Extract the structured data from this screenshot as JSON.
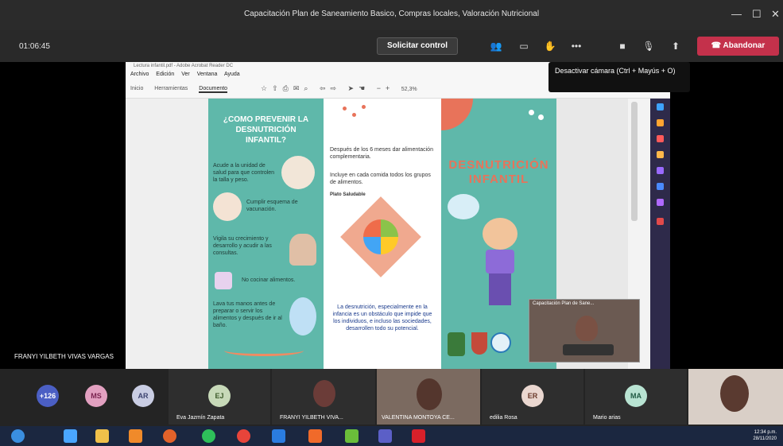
{
  "window": {
    "title": "Capacitación Plan de Saneamiento Basico, Compras locales, Valoración Nutricional",
    "minimize": "—",
    "maximize": "☐",
    "close": "✕"
  },
  "meeting": {
    "timer": "01:06:45",
    "request_control": "Solicitar control",
    "leave": "Abandonar",
    "camera_tooltip": "Desactivar cámara (Ctrl + Mayús + O)",
    "presenter": "FRANYI YILBETH VIVAS VARGAS"
  },
  "pdf": {
    "file_name": "Lectura infantil.pdf - Adobe Acrobat Reader DC",
    "menu": [
      "Archivo",
      "Edición",
      "Ver",
      "Ventana",
      "Ayuda"
    ],
    "tabs": [
      "Inicio",
      "Herramientas",
      "Documento"
    ],
    "zoom": "52,3%"
  },
  "brochure": {
    "panel1_heading": "¿COMO PREVENIR LA DESNUTRICIÓN INFANTIL?",
    "panel1_items": [
      "Acude a la unidad de salud para que controlen la talla y peso.",
      "Cumplir esquema de vacunación.",
      "Vigila su crecimiento y desarrollo y acudir a las consultas.",
      "No cocinar alimentos.",
      "Lava tus manos antes de preparar o servir los alimentos y después de ir al baño."
    ],
    "panel2_top": "Después de los 6 meses dar alimentación complementaria.",
    "panel2_mid": "Incluye en cada comida todos los grupos de alimentos.",
    "plate_title": "Plato Saludable",
    "panel2_bottom": "La desnutrición, especialmente en la infancia es un obstáculo que impide que los individuos, e incluso las sociedades, desarrollen todo su potencial.",
    "panel3_title": "DESNUTRICIÓN INFANTIL"
  },
  "thumbnail": {
    "title": "Capacitación Plan de Sane..."
  },
  "participants": [
    {
      "initials": "+126",
      "color": "#4b5fc4"
    },
    {
      "initials": "MS",
      "color": "#e2a0c0"
    },
    {
      "initials": "AR",
      "color": "#c9cde3"
    },
    {
      "initials": "EJ",
      "name": "Eva Jazmín Zapata",
      "color": "#c7d9b8"
    },
    {
      "initials": "",
      "name": "FRANYI YILBETH VIVA..."
    },
    {
      "initials": "",
      "name": "VALENTINA MONTOYA CE..."
    },
    {
      "initials": "ER",
      "name": "edilia Rosa",
      "color": "#ead7d0"
    },
    {
      "initials": "MA",
      "name": "Mario arias",
      "color": "#b8e3d2"
    }
  ],
  "taskbar": {
    "time": "12:34 p.m.",
    "date": "28/11/2020"
  }
}
